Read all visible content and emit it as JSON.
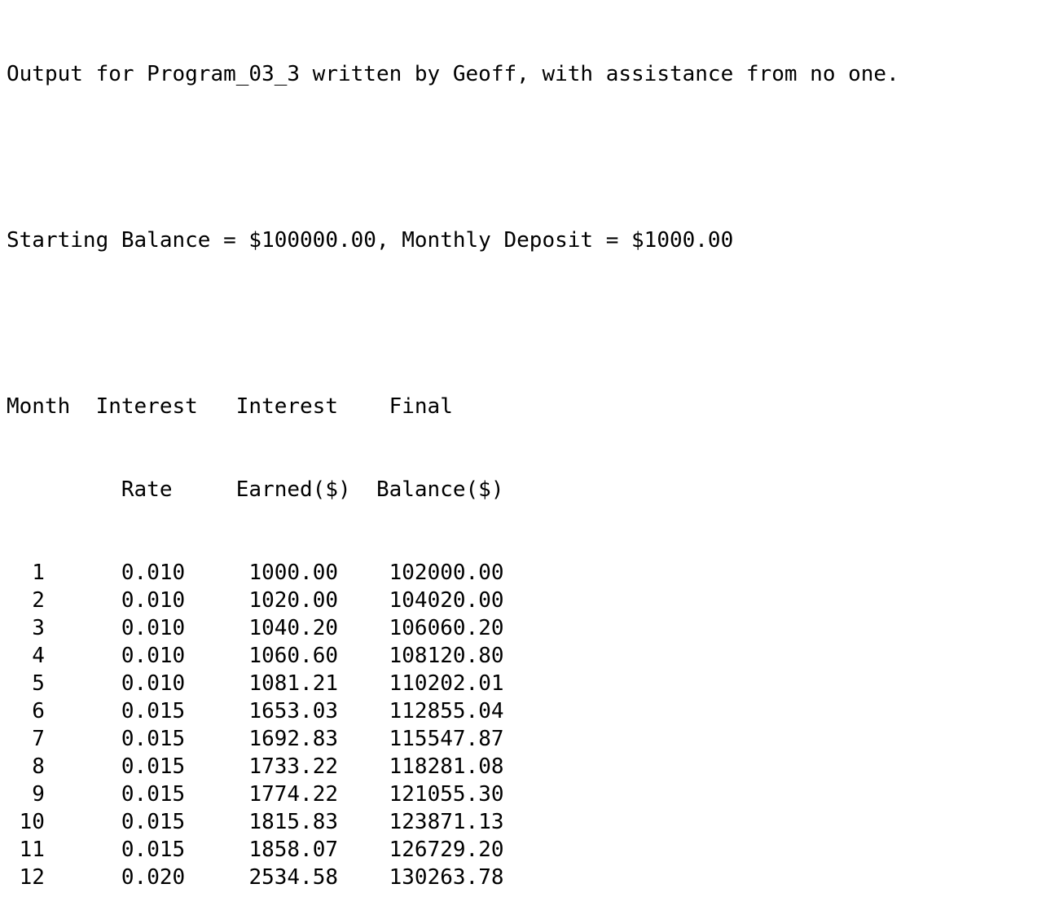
{
  "header_line": "Output for Program_03_3 written by Geoff, with assistance from no one.",
  "settings_line": "Starting Balance = $100000.00, Monthly Deposit = $1000.00",
  "column_header_1": "Month  Interest   Interest    Final",
  "column_header_2": "         Rate     Earned($)  Balance($)",
  "table": {
    "columns": [
      "Month",
      "Interest Rate",
      "Interest Earned($)",
      "Final Balance($)"
    ],
    "rows": [
      [
        "1",
        "0.010",
        "1000.00",
        "102000.00"
      ],
      [
        "2",
        "0.010",
        "1020.00",
        "104020.00"
      ],
      [
        "3",
        "0.010",
        "1040.20",
        "106060.20"
      ],
      [
        "4",
        "0.010",
        "1060.60",
        "108120.80"
      ],
      [
        "5",
        "0.010",
        "1081.21",
        "110202.01"
      ],
      [
        "6",
        "0.015",
        "1653.03",
        "112855.04"
      ],
      [
        "7",
        "0.015",
        "1692.83",
        "115547.87"
      ],
      [
        "8",
        "0.015",
        "1733.22",
        "118281.08"
      ],
      [
        "9",
        "0.015",
        "1774.22",
        "121055.30"
      ],
      [
        "10",
        "0.015",
        "1815.83",
        "123871.13"
      ],
      [
        "11",
        "0.015",
        "1858.07",
        "126729.20"
      ],
      [
        "12",
        "0.020",
        "2534.58",
        "130263.78"
      ]
    ]
  }
}
